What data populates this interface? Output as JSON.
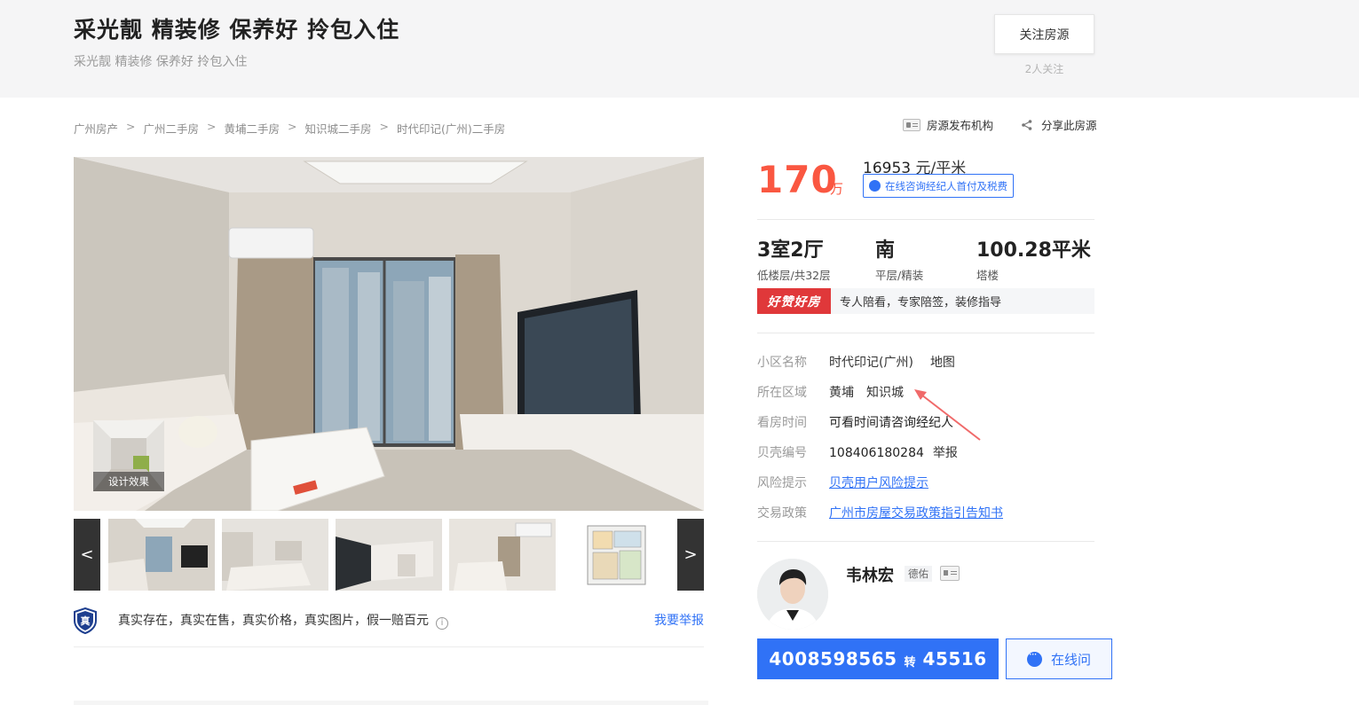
{
  "header": {
    "title": "采光靓 精装修 保养好 拎包入住",
    "subtitle": "采光靓 精装修 保养好 拎包入住",
    "follow_label": "关注房源",
    "follow_count": "2人关注"
  },
  "breadcrumb": [
    "广州房产",
    "广州二手房",
    "黄埔二手房",
    "知识城二手房",
    "时代印记(广州)二手房"
  ],
  "breadcrumb_sep": ">",
  "top_actions": {
    "agency_label": "房源发布机构",
    "share_label": "分享此房源"
  },
  "gallery": {
    "design_label": "设计效果",
    "prev_label": "<",
    "next_label": ">",
    "thumb_count": 5
  },
  "authenticity": {
    "badge": "真",
    "text": "真实存在，真实在售，真实价格，真实图片，假一赔百元",
    "info": "i",
    "report_label": "我要举报"
  },
  "price": {
    "total": "170",
    "total_unit": "万",
    "unit_price_value": "16953",
    "unit_price_unit": "元/平米",
    "consult_label": "在线咨询经纪人首付及税费"
  },
  "house_info": {
    "room": {
      "main": "3室2厅",
      "sub": "低楼层/共32层"
    },
    "orientation": {
      "main": "南",
      "sub": "平层/精装"
    },
    "area": {
      "main": "100.28平米",
      "sub": "塔楼"
    }
  },
  "promo": {
    "badge": "好赞好房",
    "text": "专人陪看，专家陪签，装修指导"
  },
  "attributes": {
    "community": {
      "label": "小区名称",
      "value": "时代印记(广州)",
      "link": "地图"
    },
    "area": {
      "label": "所在区域",
      "value1": "黄埔",
      "value2": "知识城"
    },
    "viewing": {
      "label": "看房时间",
      "value": "可看时间请咨询经纪人"
    },
    "id": {
      "label": "贝壳编号",
      "value": "108406180284",
      "link": "举报"
    },
    "risk": {
      "label": "风险提示",
      "link": "贝壳用户风险提示"
    },
    "policy": {
      "label": "交易政策",
      "link": "广州市房屋交易政策指引告知书"
    }
  },
  "agent": {
    "name": "韦林宏",
    "company": "德佑",
    "phone": "4008598565",
    "phone_sep": "转",
    "ext": "45516",
    "online_label": "在线问"
  },
  "colors": {
    "price_red": "#fa5741",
    "link_blue": "#3072f6",
    "promo_red": "#e0383a"
  }
}
